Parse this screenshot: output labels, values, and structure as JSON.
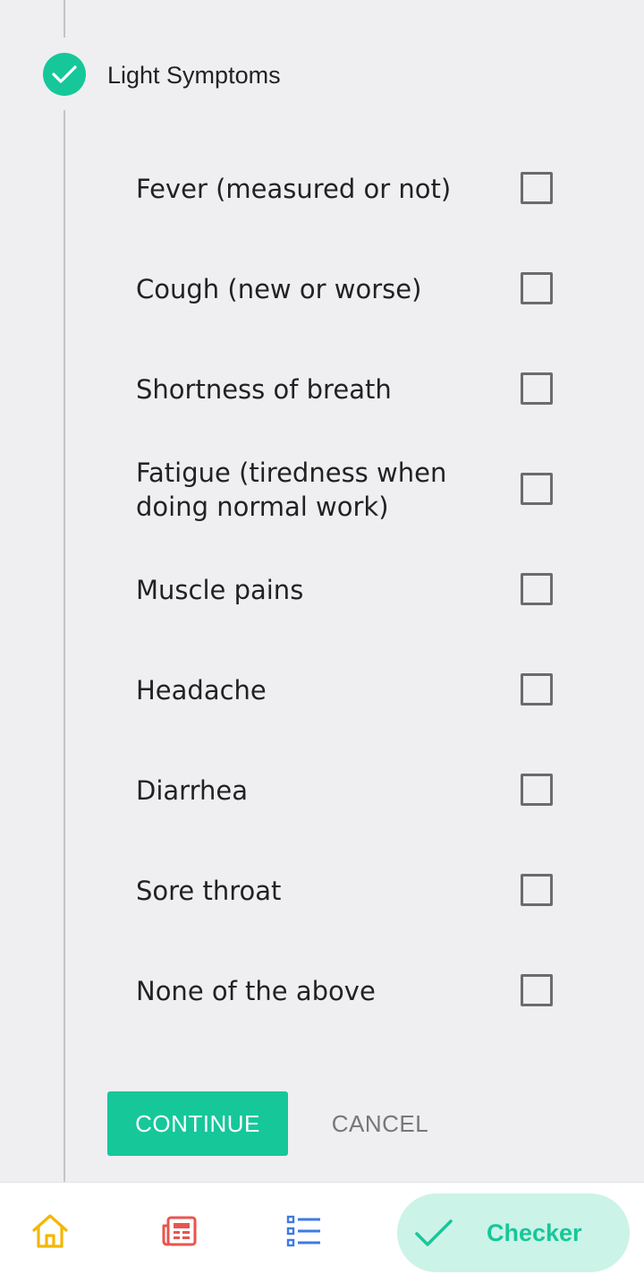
{
  "step": {
    "title": "Light Symptoms",
    "icon": "check-circle-icon",
    "accent_color": "#16c79a"
  },
  "options": [
    {
      "label": "Fever (measured or not)",
      "checked": false
    },
    {
      "label": "Cough (new or worse)",
      "checked": false
    },
    {
      "label": "Shortness of breath",
      "checked": false
    },
    {
      "label": "Fatigue (tiredness when doing normal work)",
      "checked": false
    },
    {
      "label": "Muscle pains",
      "checked": false
    },
    {
      "label": "Headache",
      "checked": false
    },
    {
      "label": "Diarrhea",
      "checked": false
    },
    {
      "label": "Sore throat",
      "checked": false
    },
    {
      "label": "None of the above",
      "checked": false
    }
  ],
  "actions": {
    "continue_label": "CONTINUE",
    "cancel_label": "CANCEL"
  },
  "bottom_nav": {
    "items": [
      {
        "icon": "home-icon",
        "color": "#f2b705"
      },
      {
        "icon": "news-icon",
        "color": "#e8554e"
      },
      {
        "icon": "list-icon",
        "color": "#3d7be0"
      }
    ],
    "active": {
      "icon": "check-icon",
      "label": "Checker",
      "color": "#16c79a",
      "background": "#ccf3e7"
    }
  }
}
